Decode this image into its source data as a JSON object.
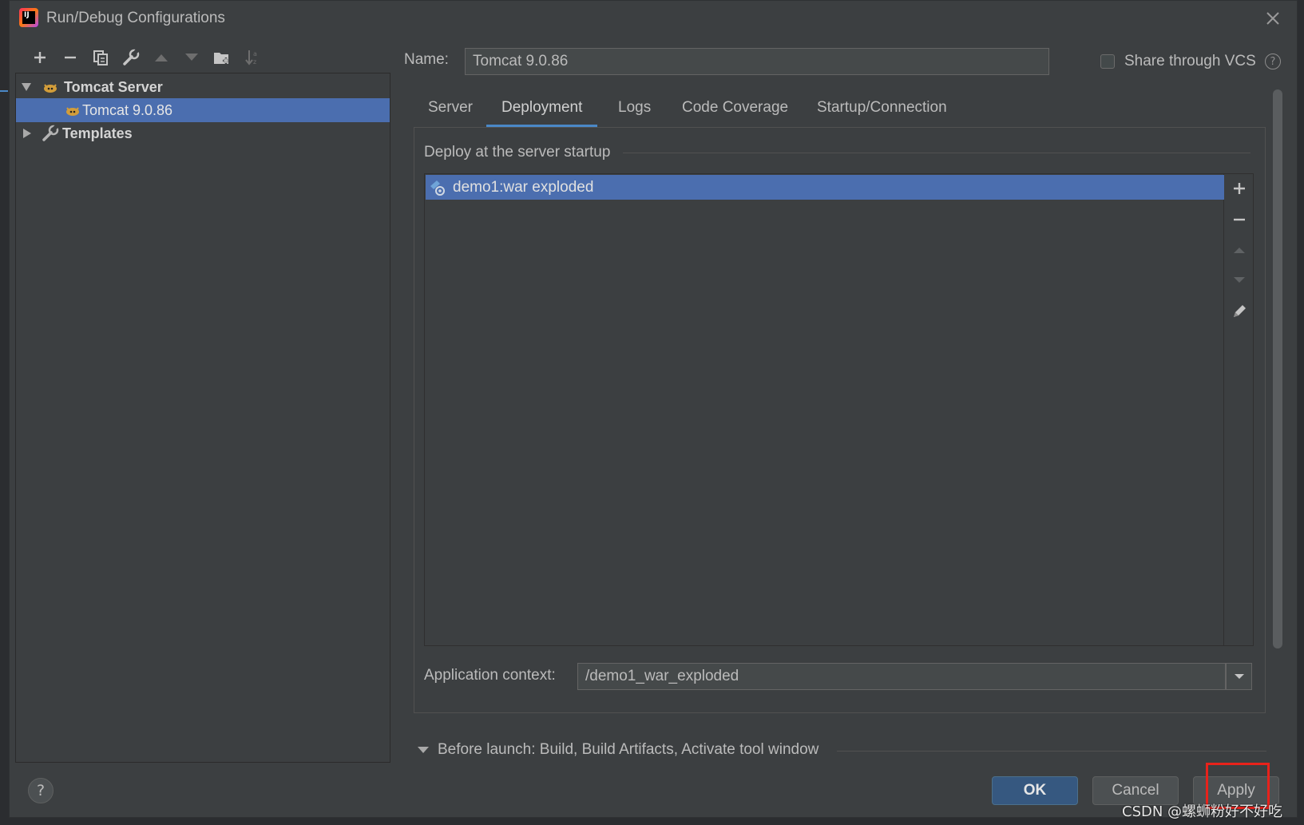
{
  "window": {
    "title": "Run/Debug Configurations",
    "app_icon_text": "IJ"
  },
  "toolbar": {
    "buttons": [
      "add-icon",
      "remove-icon",
      "copy-icon",
      "wrench-icon",
      "move-up-icon",
      "move-down-icon",
      "new-folder-icon",
      "sort-icon"
    ]
  },
  "tree": {
    "group_label": "Tomcat Server",
    "child_label": "Tomcat 9.0.86",
    "templates_label": "Templates"
  },
  "config": {
    "name_label": "Name:",
    "name_value": "Tomcat 9.0.86",
    "share_label": "Share through VCS",
    "share_checked": false,
    "help_glyph": "?"
  },
  "tabs": [
    {
      "label": "Server",
      "active": false
    },
    {
      "label": "Deployment",
      "active": true
    },
    {
      "label": "Logs",
      "active": false
    },
    {
      "label": "Code Coverage",
      "active": false
    },
    {
      "label": "Startup/Connection",
      "active": false
    }
  ],
  "deployment": {
    "section_title": "Deploy at the server startup",
    "items": [
      "demo1:war exploded"
    ],
    "context_label": "Application context:",
    "context_value": "/demo1_war_exploded"
  },
  "before_launch": {
    "label": "Before launch: Build, Build Artifacts, Activate tool window"
  },
  "buttons": {
    "ok": "OK",
    "cancel": "Cancel",
    "apply": "Apply",
    "help": "?"
  },
  "watermark": "CSDN @螺蛳粉好不好吃",
  "colors": {
    "selection": "#4b6eaf",
    "accent": "#4a88c7",
    "highlight_box": "#e8221b",
    "ok_button": "#365880"
  }
}
